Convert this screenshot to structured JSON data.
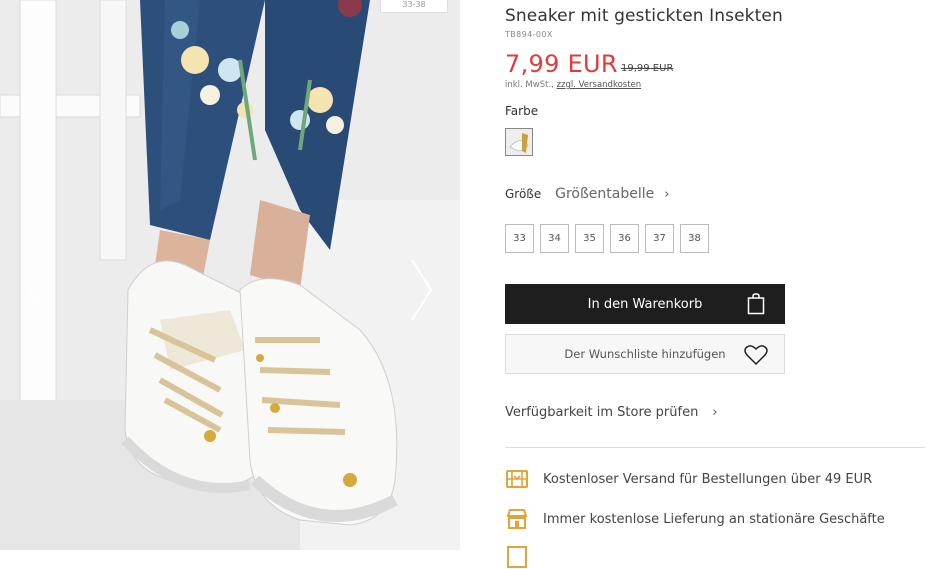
{
  "gallery": {
    "size_tag": "33-38",
    "prev_icon": "chevron-left-icon",
    "next_icon": "chevron-right-icon"
  },
  "product": {
    "title": "Sneaker mit gestickten Insekten",
    "sku": "TB894-00X",
    "price": "7,99 EUR",
    "old_price": "19,99 EUR",
    "tax_prefix": "inkl. MwSt., ",
    "tax_link": "zzgl. Versandkosten",
    "color_label": "Farbe",
    "size_label": "Größe",
    "size_guide": "Größentabelle",
    "sizes": [
      "33",
      "34",
      "35",
      "36",
      "37",
      "38"
    ],
    "add_to_cart": "In den Warenkorb",
    "wishlist": "Der Wunschliste hinzufügen",
    "store_check": "Verfügbarkeit im Store prüfen"
  },
  "benefits": [
    {
      "icon": "truck-icon",
      "text": "Kostenloser Versand für Bestellungen über 49 EUR"
    },
    {
      "icon": "store-icon",
      "text": "Immer kostenlose Lieferung an stationäre Geschäfte"
    }
  ],
  "colors": {
    "price": "#e33b3b",
    "button_dark": "#1e1e1e",
    "icon_gold": "#e0a43a"
  }
}
